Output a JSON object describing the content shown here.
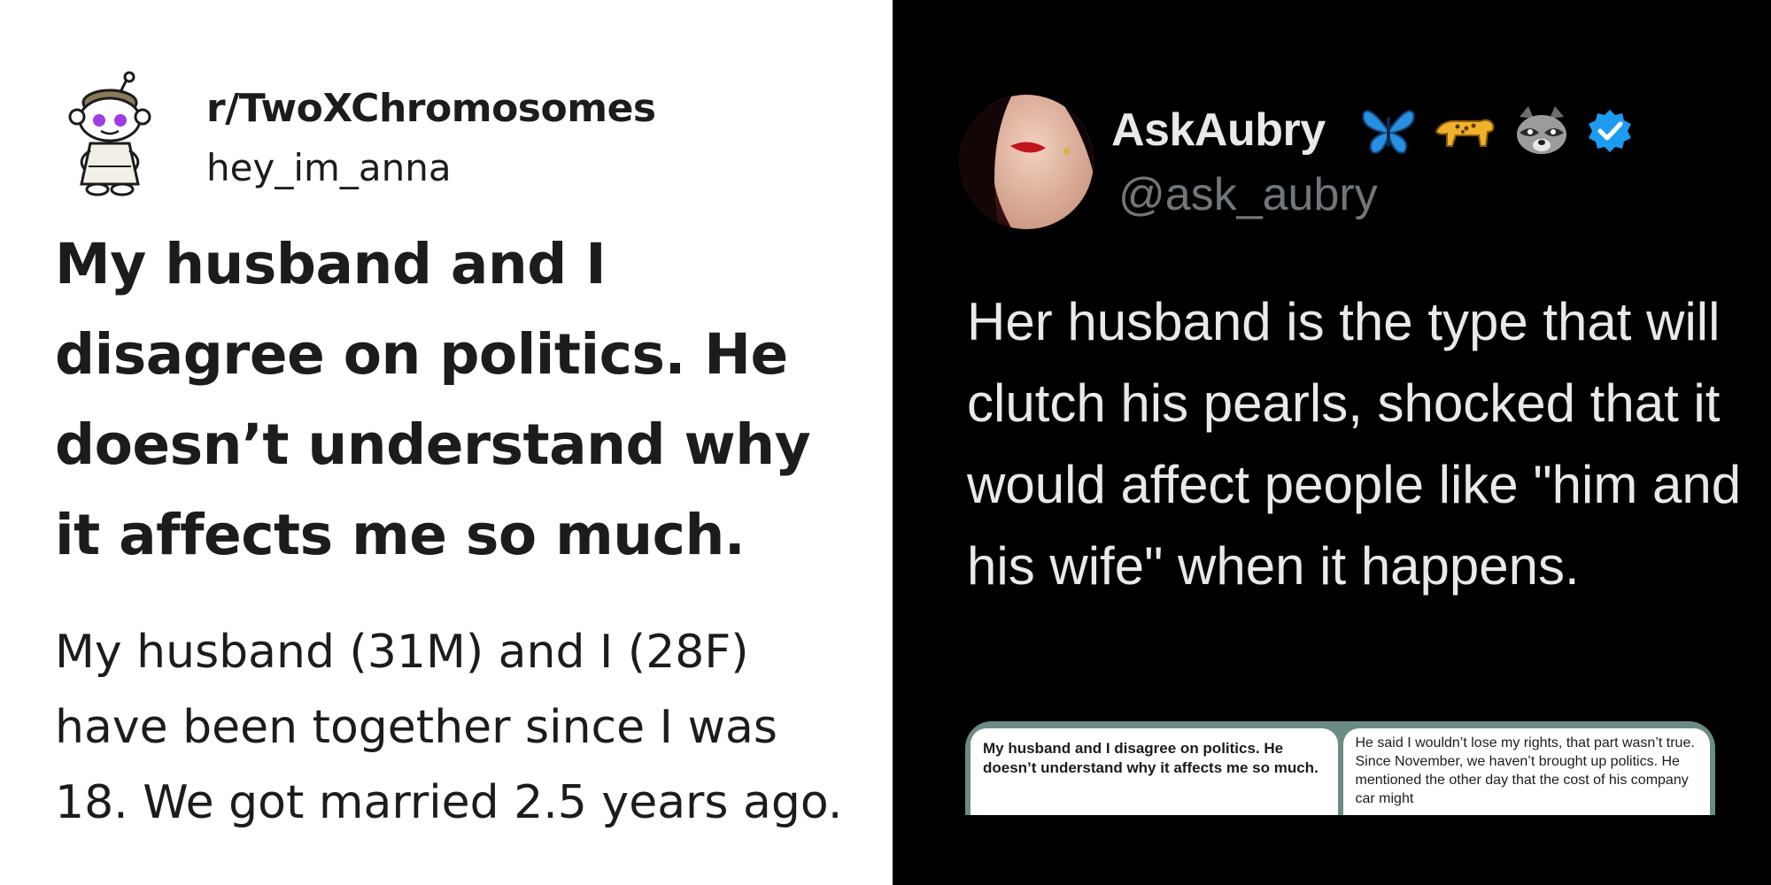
{
  "reddit": {
    "subreddit": "r/TwoXChromosomes",
    "username": "hey_im_anna",
    "title": "My husband and I disagree on politics. He doesn’t understand why it affects me so much.",
    "body": "My husband (31M) and I (28F) have been together since I was 18. We got married 2.5 years ago.",
    "avatar_icon": "snoo-avatar-icon"
  },
  "tweet": {
    "display_name": "AskAubry",
    "handle": "@ask_aubry",
    "badges": [
      "butterfly-icon",
      "leopard-icon",
      "raccoon-icon",
      "verified-badge-icon"
    ],
    "text": "Her husband is the type that will clutch his pearls, shocked that it would affect people like \"him and his wife\" when it happens.",
    "embed": {
      "left_text": "My husband and I disagree on politics. He doesn’t understand why it affects me so much.",
      "right_text": "He said I wouldn’t lose my rights, that part wasn’t true. Since November, we haven’t brought up politics. He mentioned the other day that the cost of his company car might"
    }
  },
  "colors": {
    "left_bg": "#ffffff",
    "right_bg": "#000000",
    "verified_blue": "#1d9bf0",
    "embed_border": "#6b8b87"
  }
}
